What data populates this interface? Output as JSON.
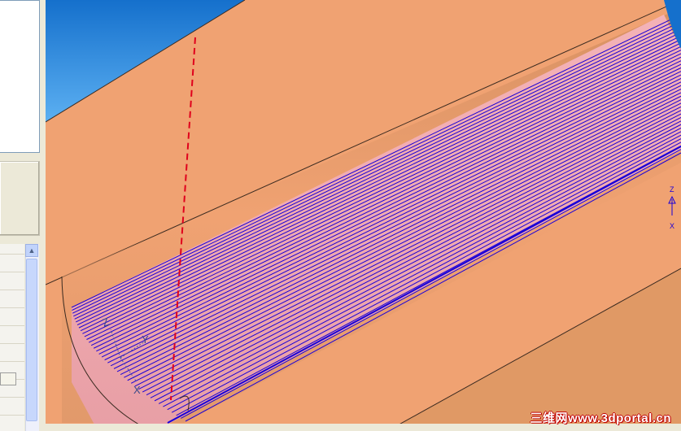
{
  "left_panel": {
    "scroll_up_glyph": "▲"
  },
  "viewport": {
    "background_top_color": "#1a7fd6",
    "background_bottom_color": "#5aaef0",
    "part_color": "#f0a272",
    "part_dark_color": "#c9875a",
    "toolpath_color": "#1a00d8",
    "toolpath_fill_color": "#f3a6b2",
    "feed_line_color": "#e0001c",
    "axis_color": "#4a5a9a"
  },
  "triad_local": {
    "z": "Z",
    "y": "Y",
    "x": "X"
  },
  "triad_global": {
    "z": "Z",
    "x": "X"
  },
  "watermark": "三维网www.3dportal.cn"
}
